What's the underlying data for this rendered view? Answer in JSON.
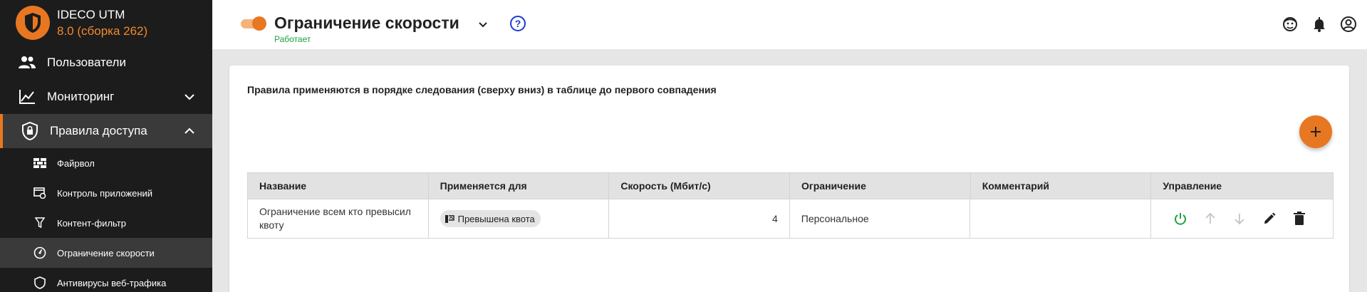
{
  "brand": {
    "name": "IDECO UTM",
    "version": "8.0 (сборка 262)"
  },
  "sidebar": {
    "items": [
      {
        "label": "Пользователи",
        "icon": "users-icon"
      },
      {
        "label": "Мониторинг",
        "icon": "chart-line-icon",
        "expanded": false
      },
      {
        "label": "Правила доступа",
        "icon": "shield-lock-icon",
        "expanded": true,
        "active": true
      }
    ],
    "subitems": [
      {
        "label": "Файрвол",
        "icon": "brick-wall-icon"
      },
      {
        "label": "Контроль приложений",
        "icon": "app-control-icon"
      },
      {
        "label": "Контент-фильтр",
        "icon": "funnel-icon"
      },
      {
        "label": "Ограничение скорости",
        "icon": "speedometer-icon",
        "current": true
      },
      {
        "label": "Антивирусы веб-трафика",
        "icon": "shield-icon"
      }
    ]
  },
  "header": {
    "title": "Ограничение скорости",
    "status": "Работает",
    "help": "?",
    "enabled": true
  },
  "main": {
    "info": "Правила применяются в порядке следования (сверху вниз) в таблице до первого совпадения",
    "add_button": "+",
    "table": {
      "columns": [
        "Название",
        "Применяется для",
        "Скорость (Мбит/с)",
        "Ограничение",
        "Комментарий",
        "Управление"
      ],
      "rows": [
        {
          "name": "Ограничение всем кто превысил квоту",
          "applies_to": "Превышена квота",
          "speed": "4",
          "limit": "Персональное",
          "comment": ""
        }
      ]
    }
  },
  "colors": {
    "accent": "#e87722",
    "sidebar_bg": "#1c1c1c",
    "status_ok": "#1ea23e",
    "help": "#1a3ccf"
  }
}
